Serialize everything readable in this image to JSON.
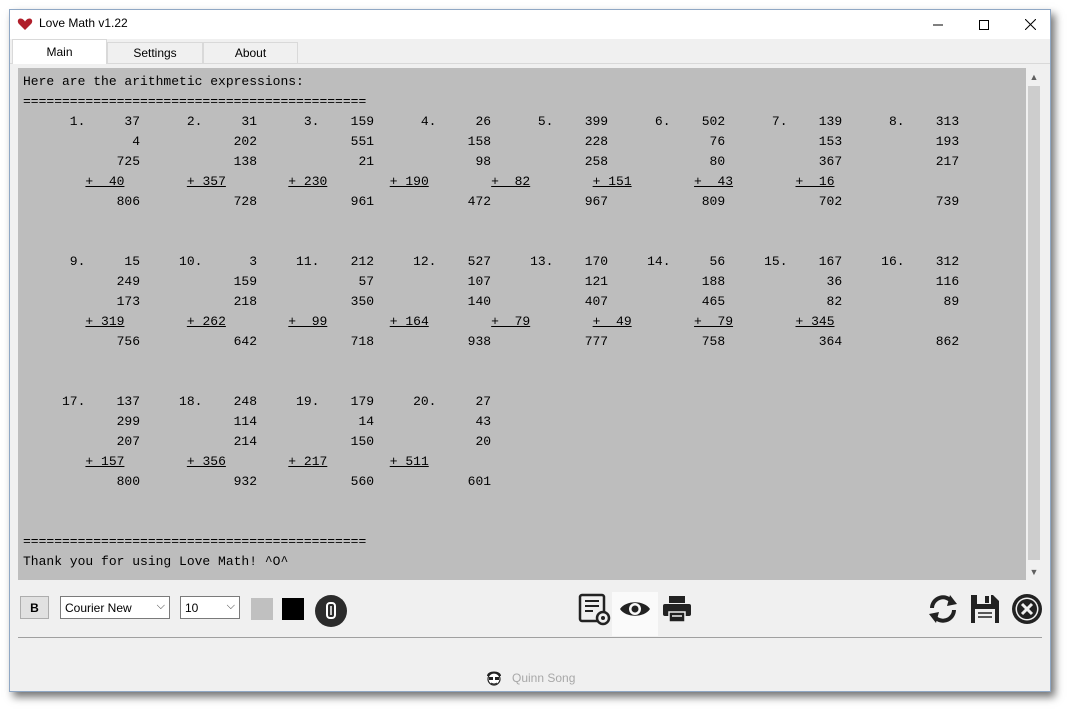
{
  "window": {
    "title": "Love Math v1.22",
    "controls": {
      "minimize": "—",
      "maximize": "☐",
      "close": "✕"
    }
  },
  "tabs": [
    {
      "label": "Main"
    },
    {
      "label": "Settings"
    },
    {
      "label": "About"
    }
  ],
  "output": {
    "header": "Here are the arithmetic expressions:",
    "separator": "============================================",
    "problems": [
      {
        "n": "1.",
        "terms": [
          "37",
          "4",
          "725",
          "40"
        ],
        "sum": "806"
      },
      {
        "n": "2.",
        "terms": [
          "31",
          "202",
          "138",
          "357"
        ],
        "sum": "728"
      },
      {
        "n": "3.",
        "terms": [
          "159",
          "551",
          "21",
          "230"
        ],
        "sum": "961"
      },
      {
        "n": "4.",
        "terms": [
          "26",
          "158",
          "98",
          "190"
        ],
        "sum": "472"
      },
      {
        "n": "5.",
        "terms": [
          "399",
          "228",
          "258",
          "82"
        ],
        "sum": "967"
      },
      {
        "n": "6.",
        "terms": [
          "502",
          "76",
          "80",
          "151"
        ],
        "sum": "809"
      },
      {
        "n": "7.",
        "terms": [
          "139",
          "153",
          "367",
          "43"
        ],
        "sum": "702"
      },
      {
        "n": "8.",
        "terms": [
          "313",
          "193",
          "217",
          "16"
        ],
        "sum": "739"
      },
      {
        "n": "9.",
        "terms": [
          "15",
          "249",
          "173",
          "319"
        ],
        "sum": "756"
      },
      {
        "n": "10.",
        "terms": [
          "3",
          "159",
          "218",
          "262"
        ],
        "sum": "642"
      },
      {
        "n": "11.",
        "terms": [
          "212",
          "57",
          "350",
          "99"
        ],
        "sum": "718"
      },
      {
        "n": "12.",
        "terms": [
          "527",
          "107",
          "140",
          "164"
        ],
        "sum": "938"
      },
      {
        "n": "13.",
        "terms": [
          "170",
          "121",
          "407",
          "79"
        ],
        "sum": "777"
      },
      {
        "n": "14.",
        "terms": [
          "56",
          "188",
          "465",
          "49"
        ],
        "sum": "758"
      },
      {
        "n": "15.",
        "terms": [
          "167",
          "36",
          "82",
          "79"
        ],
        "sum": "364"
      },
      {
        "n": "16.",
        "terms": [
          "312",
          "116",
          "89",
          "345"
        ],
        "sum": "862"
      },
      {
        "n": "17.",
        "terms": [
          "137",
          "299",
          "207",
          "157"
        ],
        "sum": "800"
      },
      {
        "n": "18.",
        "terms": [
          "248",
          "114",
          "214",
          "356"
        ],
        "sum": "932"
      },
      {
        "n": "19.",
        "terms": [
          "179",
          "14",
          "150",
          "217"
        ],
        "sum": "560"
      },
      {
        "n": "20.",
        "terms": [
          "27",
          "43",
          "20",
          "511"
        ],
        "sum": "601"
      }
    ],
    "per_row": 8,
    "footer": "Thank you for using Love Math! ^O^"
  },
  "toolbar": {
    "bold_label": "B",
    "font_family": "Courier New",
    "font_size": "10",
    "bg_color": "#c0c0c0",
    "fg_color": "#000000",
    "icons": {
      "clear": "clear-circle-icon",
      "settings": "document-settings-icon",
      "preview": "eye-icon",
      "print": "printer-icon",
      "refresh": "refresh-icon",
      "save": "floppy-disk-icon",
      "exit": "close-circle-icon"
    }
  },
  "footer": {
    "author": "Quinn Song",
    "avatar": "author-avatar-icon"
  }
}
